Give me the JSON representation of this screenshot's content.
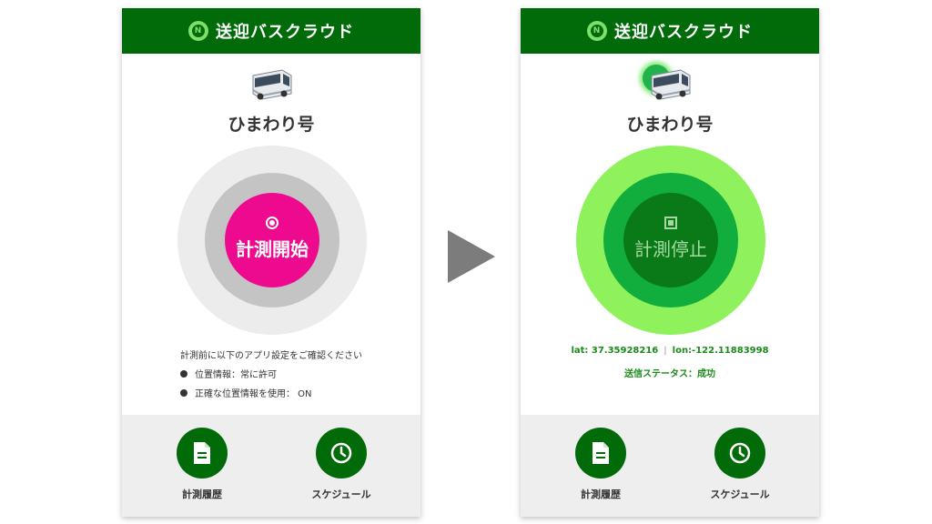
{
  "app_title": "送迎バスクラウド",
  "colors": {
    "header_green": "#006b08",
    "start_button": "#ed0a8e",
    "stop_button": "#0a7a19",
    "active_ring": "#8ff25c",
    "arrow": "#7c7c7c"
  },
  "left_screen": {
    "bus_name": "ひまわり号",
    "bus_icon": "bus-icon",
    "button_icon": "target-icon",
    "button_label": "計測開始",
    "notice": "計測前に以下のアプリ設定をご確認ください",
    "settings": [
      {
        "label": "位置情報：常に許可"
      },
      {
        "label": "正確な位置情報を使用： ON"
      }
    ],
    "nav": [
      {
        "label": "計測履歴",
        "icon": "document-icon"
      },
      {
        "label": "スケジュール",
        "icon": "clock-icon"
      }
    ]
  },
  "right_screen": {
    "bus_name": "ひまわり号",
    "bus_icon": "bus-icon",
    "button_icon": "stop-icon",
    "button_label": "計測停止",
    "lat": "lat: 37.35928216",
    "lon": "lon:-122.11883998",
    "status": "送信ステータス：成功",
    "nav": [
      {
        "label": "計測履歴",
        "icon": "document-icon"
      },
      {
        "label": "スケジュール",
        "icon": "clock-icon"
      }
    ]
  }
}
